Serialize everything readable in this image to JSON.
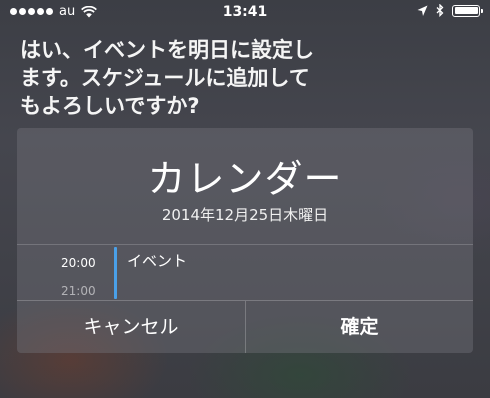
{
  "status_bar": {
    "carrier": "au",
    "time": "13:41",
    "signal_dots": 5,
    "battery_level": 1.0,
    "icons": [
      "signal-dots-icon",
      "wifi-icon",
      "location-arrow-icon",
      "bluetooth-icon",
      "battery-icon"
    ]
  },
  "siri": {
    "message": "はい、イベントを明日に設定し\nます。スケジュールに追加して\nもよろしいですか?"
  },
  "card": {
    "title": "カレンダー",
    "date": "2014年12月25日木曜日",
    "times": [
      "20:00",
      "21:00"
    ],
    "event": {
      "label": "イベント",
      "color": "#4aa0e8"
    },
    "buttons": {
      "cancel": "キャンセル",
      "confirm": "確定"
    }
  }
}
